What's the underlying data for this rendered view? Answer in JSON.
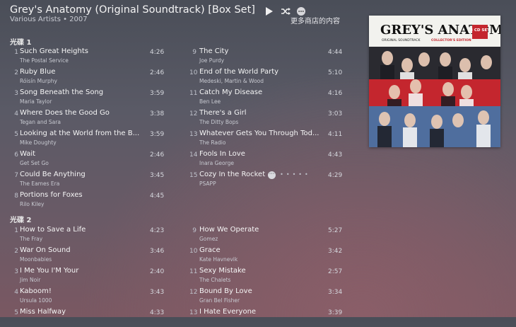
{
  "album": {
    "title": "Grey's Anatomy (Original Soundtrack) [Box Set]",
    "subtitle": "Various Artists • 2007",
    "store_link": "更多商店的内容"
  },
  "controls": [
    {
      "name": "play-icon"
    },
    {
      "name": "shuffle-icon"
    },
    {
      "name": "more-icon"
    }
  ],
  "art": {
    "title": "GREY'S ANATOMY",
    "subtitle": "ORIGINAL SOUNDTRACK",
    "badge": "3 CD SET",
    "edition": "COLLECTOR'S EDITION",
    "colors": {
      "top": "#f2f2ee",
      "red": "#c4262e",
      "blue": "#4f6e9e"
    }
  },
  "disc1": {
    "label": "光碟 1",
    "left": [
      {
        "num": "1",
        "title": "Such Great Heights",
        "artist": "The Postal Service",
        "duration": "4:26"
      },
      {
        "num": "2",
        "title": "Ruby Blue",
        "artist": "Róisín Murphy",
        "duration": "2:46"
      },
      {
        "num": "3",
        "title": "Song Beneath the Song",
        "artist": "Maria Taylor",
        "duration": "3:59"
      },
      {
        "num": "4",
        "title": "Where Does the Good Go",
        "artist": "Tegan and Sara",
        "duration": "3:38"
      },
      {
        "num": "5",
        "title": "Looking at the World from the B...",
        "artist": "Mike Doughty",
        "duration": "3:59"
      },
      {
        "num": "6",
        "title": "Wait",
        "artist": "Get Set Go",
        "duration": "2:46"
      },
      {
        "num": "7",
        "title": "Could Be Anything",
        "artist": "The Eames Era",
        "duration": "3:45"
      },
      {
        "num": "8",
        "title": "Portions for Foxes",
        "artist": "Rilo Kiley",
        "duration": "4:45"
      }
    ],
    "right": [
      {
        "num": "9",
        "title": "The City",
        "artist": "Joe Purdy",
        "duration": "4:44"
      },
      {
        "num": "10",
        "title": "End of the World Party",
        "artist": "Medeski, Martin & Wood",
        "duration": "5:10"
      },
      {
        "num": "11",
        "title": "Catch My Disease",
        "artist": "Ben Lee",
        "duration": "4:16"
      },
      {
        "num": "12",
        "title": "There's a Girl",
        "artist": "The Ditty Bops",
        "duration": "3:03"
      },
      {
        "num": "13",
        "title": "Whatever Gets You Through Tod...",
        "artist": "The Radio",
        "duration": "4:11"
      },
      {
        "num": "14",
        "title": "Fools In Love",
        "artist": "Inara George",
        "duration": "4:43"
      },
      {
        "num": "15",
        "title": "Cozy In the Rocket",
        "artist": "PSAPP",
        "duration": "4:29"
      }
    ]
  },
  "disc2": {
    "label": "光碟 2",
    "left": [
      {
        "num": "1",
        "title": "How to Save a Life",
        "artist": "The Fray",
        "duration": "4:23"
      },
      {
        "num": "2",
        "title": "War On Sound",
        "artist": "Moonbabies",
        "duration": "3:46"
      },
      {
        "num": "3",
        "title": "I Me You I'M Your",
        "artist": "Jim Noir",
        "duration": "2:40"
      },
      {
        "num": "4",
        "title": "Kaboom!",
        "artist": "Ursula 1000",
        "duration": "3:43"
      },
      {
        "num": "5",
        "title": "Miss Halfway",
        "artist": "",
        "duration": "4:33"
      }
    ],
    "right": [
      {
        "num": "9",
        "title": "How We Operate",
        "artist": "Gomez",
        "duration": "5:27"
      },
      {
        "num": "10",
        "title": "Grace",
        "artist": "Kate Havnevik",
        "duration": "3:42"
      },
      {
        "num": "11",
        "title": "Sexy Mistake",
        "artist": "The Chalets",
        "duration": "2:57"
      },
      {
        "num": "12",
        "title": "Bound By Love",
        "artist": "Gran Bel Fisher",
        "duration": "3:34"
      },
      {
        "num": "13",
        "title": "I Hate Everyone",
        "artist": "",
        "duration": "3:39"
      }
    ]
  }
}
